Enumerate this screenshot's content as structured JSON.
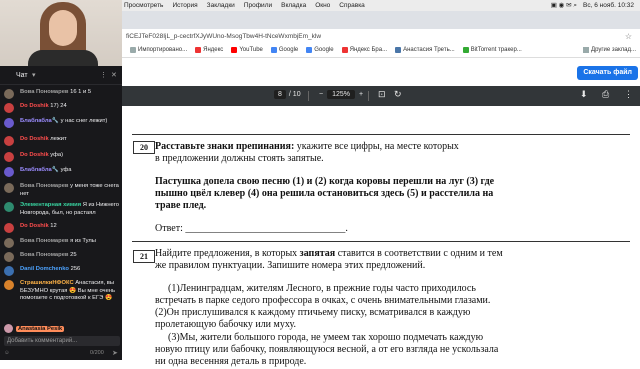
{
  "menubar": {
    "items": [
      "Просмотреть",
      "История",
      "Закладки",
      "Профили",
      "Вкладка",
      "Окно",
      "Справка"
    ],
    "datetime": "Вс, 6 нояб. 10:32"
  },
  "urlbar": {
    "url": "fiCEJTeF028IjL_p-cectrfXJyWUno-MsogTbw4H-tNceWxmbjEm_klw"
  },
  "bookmarks": {
    "items": [
      "Импортировано...",
      "Яндекс",
      "YouTube",
      "Google",
      "Google",
      "Яндекс Бра...",
      "Анастасия Треть...",
      "BitTorrent тракер..."
    ],
    "other_label": "Другие заклад..."
  },
  "download_button": "Скачать файл",
  "pdf_toolbar": {
    "current_page": "8",
    "total_pages": "/ 10",
    "zoom": "125%",
    "zoom_minus": "−",
    "zoom_plus": "+"
  },
  "pdf": {
    "q20_num": "20",
    "q20_title": "Расставьте знаки препинания:",
    "q20_rest": " укажите все цифры, на месте которых",
    "q20_line2": "в предложении должны стоять запятые.",
    "q20_s1": "Пастушка допела свою песню (1) и (2) когда коровы перешли на луг (3) где",
    "q20_s2": "пышно цвёл клевер (4) она решила остановиться здесь (5) и расстелила на",
    "q20_s3": "траве плед.",
    "q20_answer": "Ответ: ________________________________.",
    "q21_num": "21",
    "q21_line1_a": "Найдите предложения, в которых ",
    "q21_line1_b": "запятая",
    "q21_line1_c": " ставится в соответствии с одним и тем",
    "q21_line2": "же правилом пунктуации. Запишите номера этих предложений.",
    "p1": "(1)Ленинградцам, жителям Лесного, в прежние годы часто приходилось",
    "p2": "встречать в парке седого профессора в очках, с очень внимательными глазами.",
    "p3": "(2)Он прислушивался к каждому птичьему писку, всматривался в каждую",
    "p4": "пролетающую бабочку или муху.",
    "p5": "(3)Мы, жители большого города, не умеем так хорошо подмечать каждую",
    "p6": "новую птицу или бабочку, появляющуюся весной, а от его взгляда не ускользала",
    "p7": "ни одна весенняя деталь в природе."
  },
  "chat": {
    "title": "Чат",
    "messages": [
      {
        "user": "Вова Пономарев",
        "text": "16 1 и 5",
        "color": "#a0a0a0"
      },
      {
        "user": "Do Doshik",
        "text": "17) 24",
        "color": "#ff4d4d"
      },
      {
        "user": "Блаблабла🔧",
        "text": "у нас снег лежит)",
        "color": "#9b8cff"
      },
      {
        "user": "Do Doshik",
        "text": "лежит",
        "color": "#ff4d4d"
      },
      {
        "user": "Do Doshik",
        "text": "уфа)",
        "color": "#ff4d4d"
      },
      {
        "user": "Блаблабла🔧",
        "text": "уфа",
        "color": "#9b8cff"
      },
      {
        "user": "Вова Пономарев",
        "text": "у меня тоже снега нет",
        "color": "#a0a0a0"
      },
      {
        "user": "Элементарная химия",
        "text": "Я из Нижнего Новгорода, был, но растаял",
        "color": "#39d3a0"
      },
      {
        "user": "Do Doshik",
        "text": "12",
        "color": "#ff4d4d"
      },
      {
        "user": "Вова Пономарев",
        "text": "я из Тулы",
        "color": "#a0a0a0"
      },
      {
        "user": "Вова Пономарев",
        "text": "25",
        "color": "#a0a0a0"
      },
      {
        "user": "Danil Domchenko",
        "text": "256",
        "color": "#4da3ff"
      },
      {
        "user": "СтрашилкиНФОКС",
        "text": "Анастасия, вы БЕЗУМНО крутая 😍 Вы мне очень помогаете с подготовкой к ЕГЭ 😍",
        "color": "#ffb347"
      }
    ],
    "current_user": "Anastasia Pesik",
    "input_placeholder": "Добавить комментарий...",
    "char_count": "0/200"
  }
}
